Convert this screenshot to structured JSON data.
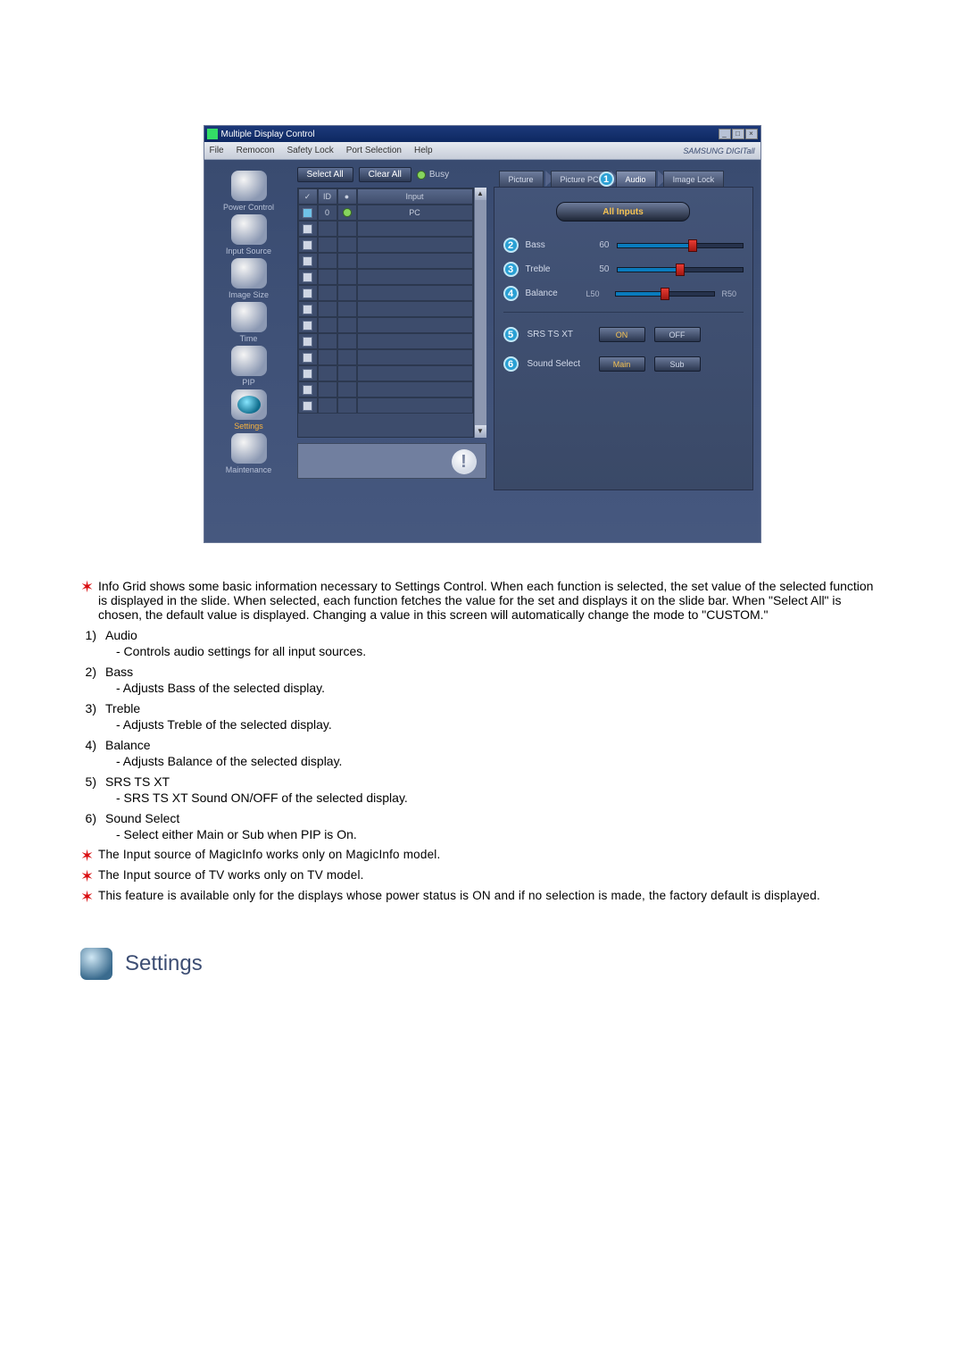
{
  "window": {
    "title": "Multiple Display Control",
    "brand": "SAMSUNG DIGITall"
  },
  "menu": {
    "file": "File",
    "remocon": "Remocon",
    "safety_lock": "Safety Lock",
    "port_selection": "Port Selection",
    "help": "Help"
  },
  "sidebar": {
    "items": [
      {
        "label": "Power Control"
      },
      {
        "label": "Input Source"
      },
      {
        "label": "Image Size"
      },
      {
        "label": "Time"
      },
      {
        "label": "PIP"
      },
      {
        "label": "Settings"
      },
      {
        "label": "Maintenance"
      }
    ]
  },
  "toolbar": {
    "select_all": "Select All",
    "clear_all": "Clear All",
    "busy": "Busy"
  },
  "grid": {
    "head_check": "✓",
    "head_id": "ID",
    "head_status": "⬤",
    "head_input": "Input",
    "rows": [
      {
        "id": "0",
        "input": "PC",
        "checked": true,
        "status": true
      }
    ]
  },
  "tabs": {
    "picture": "Picture",
    "picture_pc": "Picture PC",
    "audio": "Audio",
    "image_lock": "Image Lock"
  },
  "panel": {
    "all_inputs": "All Inputs",
    "bass_label": "Bass",
    "bass_val": "60",
    "treble_label": "Treble",
    "treble_val": "50",
    "balance_label": "Balance",
    "balance_left": "L50",
    "balance_right": "R50",
    "srs_label": "SRS TS XT",
    "on": "ON",
    "off": "OFF",
    "sound_select_label": "Sound Select",
    "main": "Main",
    "sub": "Sub"
  },
  "callouts": {
    "1": "1",
    "2": "2",
    "3": "3",
    "4": "4",
    "5": "5",
    "6": "6"
  },
  "doc": {
    "intro": "Info Grid shows some basic information necessary to Settings Control. When each function is selected, the set value of the selected function is displayed in the slide. When selected, each function fetches the value for the set and displays it on the slide bar. When \"Select All\" is chosen, the default value is displayed. Changing a value in this screen will automatically change the mode to \"CUSTOM.\"",
    "items": [
      {
        "n": "1)",
        "t": "Audio",
        "d": "- Controls audio settings for all input sources."
      },
      {
        "n": "2)",
        "t": "Bass",
        "d": "- Adjusts Bass of the selected display."
      },
      {
        "n": "3)",
        "t": "Treble",
        "d": "- Adjusts Treble of the selected display."
      },
      {
        "n": "4)",
        "t": "Balance",
        "d": "- Adjusts Balance of the selected display."
      },
      {
        "n": "5)",
        "t": "SRS TS XT",
        "d": "- SRS TS XT Sound ON/OFF of the selected display."
      },
      {
        "n": "6)",
        "t": "Sound Select",
        "d": "- Select either Main or Sub when PIP is On."
      }
    ],
    "note1": "The Input source of MagicInfo works only on MagicInfo model.",
    "note2": "The Input source of TV works only on TV model.",
    "note3": "This feature is available only for the displays whose power status is ON and if no selection is made, the factory default is displayed.",
    "section_title": "Settings"
  }
}
